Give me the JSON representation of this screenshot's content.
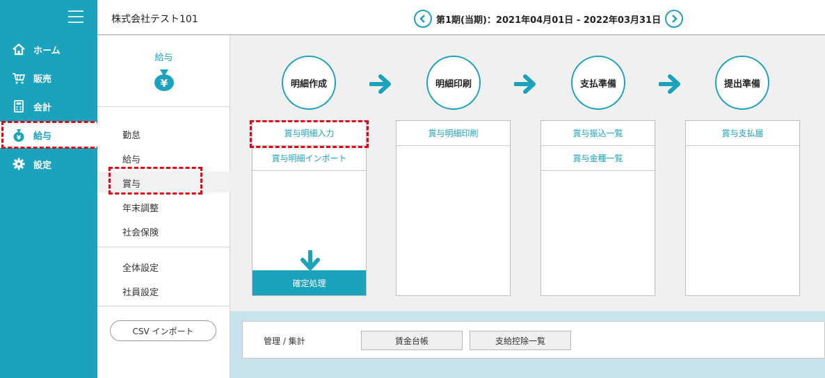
{
  "header": {
    "company": "株式会社テスト101",
    "period": "第1期(当期)：2021年04月01日 - 2022年03月31日"
  },
  "sidebar": {
    "items": [
      {
        "label": "ホーム",
        "icon": "home-icon"
      },
      {
        "label": "販売",
        "icon": "cart-icon"
      },
      {
        "label": "会計",
        "icon": "calculator-icon"
      },
      {
        "label": "給与",
        "icon": "money-bag-icon",
        "active": true
      },
      {
        "label": "設定",
        "icon": "gear-icon"
      }
    ]
  },
  "subnav": {
    "title": "給与",
    "group1": [
      "勤怠",
      "給与",
      "賞与",
      "年末調整",
      "社会保険"
    ],
    "group2": [
      "全体設定",
      "社員設定"
    ],
    "csv_button": "CSV インポート",
    "active_item": "賞与"
  },
  "steps": [
    {
      "title": "明細作成",
      "links": [
        "賞与明細入力",
        "賞与明細インポート"
      ],
      "confirm": "確定処理"
    },
    {
      "title": "明細印刷",
      "links": [
        "賞与明細印刷"
      ]
    },
    {
      "title": "支払準備",
      "links": [
        "賞与振込一覧",
        "賞与金種一覧"
      ]
    },
    {
      "title": "提出準備",
      "links": [
        "賞与支払届"
      ]
    }
  ],
  "management": {
    "label": "管理 / 集計",
    "buttons": [
      "賃金台帳",
      "支給控除一覧"
    ]
  },
  "colors": {
    "accent": "#1ba3bd",
    "highlight": "#e60012"
  }
}
